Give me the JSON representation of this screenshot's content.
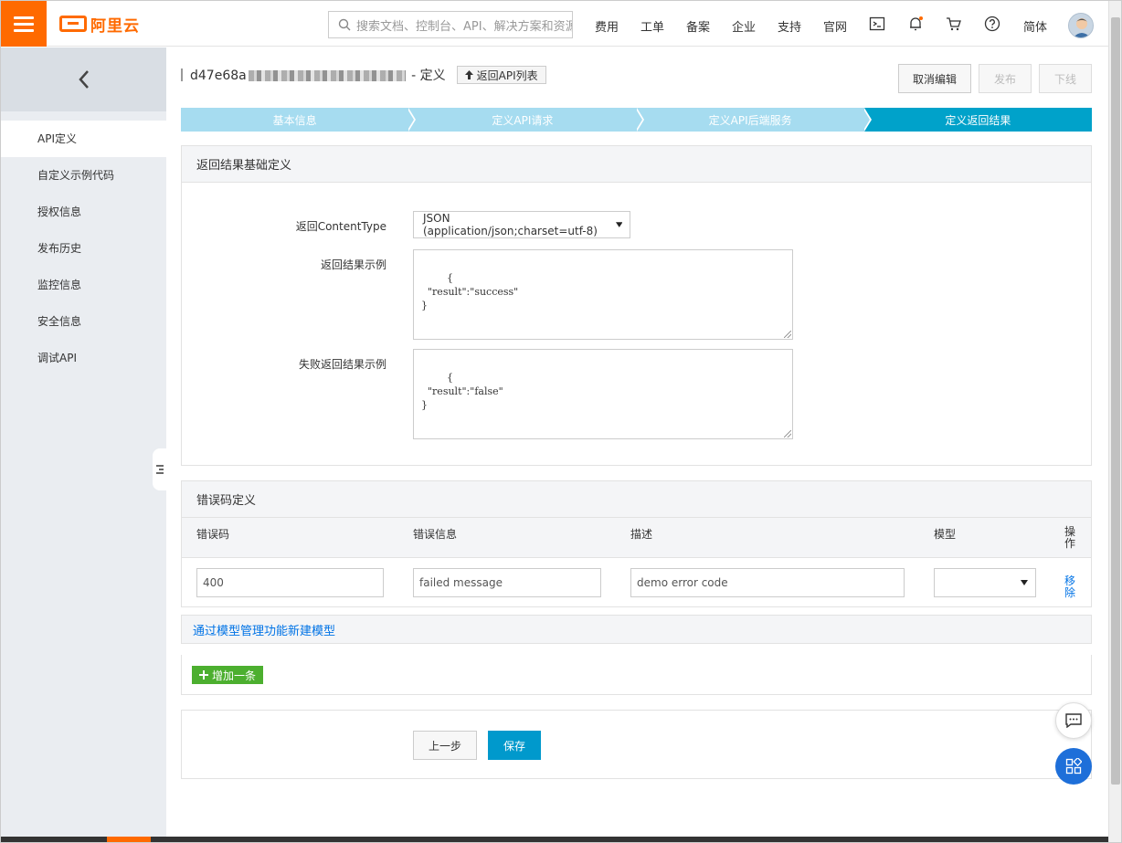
{
  "brand": {
    "name": "阿里云"
  },
  "search": {
    "placeholder": "搜索文档、控制台、API、解决方案和资源"
  },
  "top_nav": [
    "费用",
    "工单",
    "备案",
    "企业",
    "支持",
    "官网"
  ],
  "language": "简体",
  "sidebar": {
    "items": [
      {
        "label": "API定义",
        "active": true
      },
      {
        "label": "自定义示例代码",
        "active": false
      },
      {
        "label": "授权信息",
        "active": false
      },
      {
        "label": "发布历史",
        "active": false
      },
      {
        "label": "监控信息",
        "active": false
      },
      {
        "label": "安全信息",
        "active": false
      },
      {
        "label": "调试API",
        "active": false
      }
    ]
  },
  "header": {
    "api_id_prefix": "d47e68a",
    "title_suffix": " - 定义",
    "back_label": "返回API列表",
    "actions": {
      "cancel_edit": "取消编辑",
      "publish": "发布",
      "offline": "下线"
    }
  },
  "steps": [
    {
      "label": "基本信息",
      "active": false
    },
    {
      "label": "定义API请求",
      "active": false
    },
    {
      "label": "定义API后端服务",
      "active": false
    },
    {
      "label": "定义返回结果",
      "active": true
    }
  ],
  "result_section": {
    "title": "返回结果基础定义",
    "content_type_label": "返回ContentType",
    "content_type_value": "JSON (application/json;charset=utf-8)",
    "success_label": "返回结果示例",
    "success_example": "{\n  \"result\":\"success\"\n}",
    "failure_label": "失败返回结果示例",
    "failure_example": "{\n  \"result\":\"false\"\n}"
  },
  "error_section": {
    "title": "错误码定义",
    "columns": [
      "错误码",
      "错误信息",
      "描述",
      "模型",
      "操作"
    ],
    "rows": [
      {
        "code": "400",
        "message": "failed message",
        "description": "demo error code",
        "model": "",
        "action": "移除"
      }
    ]
  },
  "model_link": "通过模型管理功能新建模型",
  "add_row_label": "增加一条",
  "footer": {
    "prev_label": "上一步",
    "save_label": "保存"
  },
  "colors": {
    "brand": "#ff6a00",
    "step_active": "#00a2ca",
    "step_inactive": "#a6dcf0",
    "primary": "#0099cc",
    "add": "#4caf2f",
    "link": "#0073e6"
  }
}
